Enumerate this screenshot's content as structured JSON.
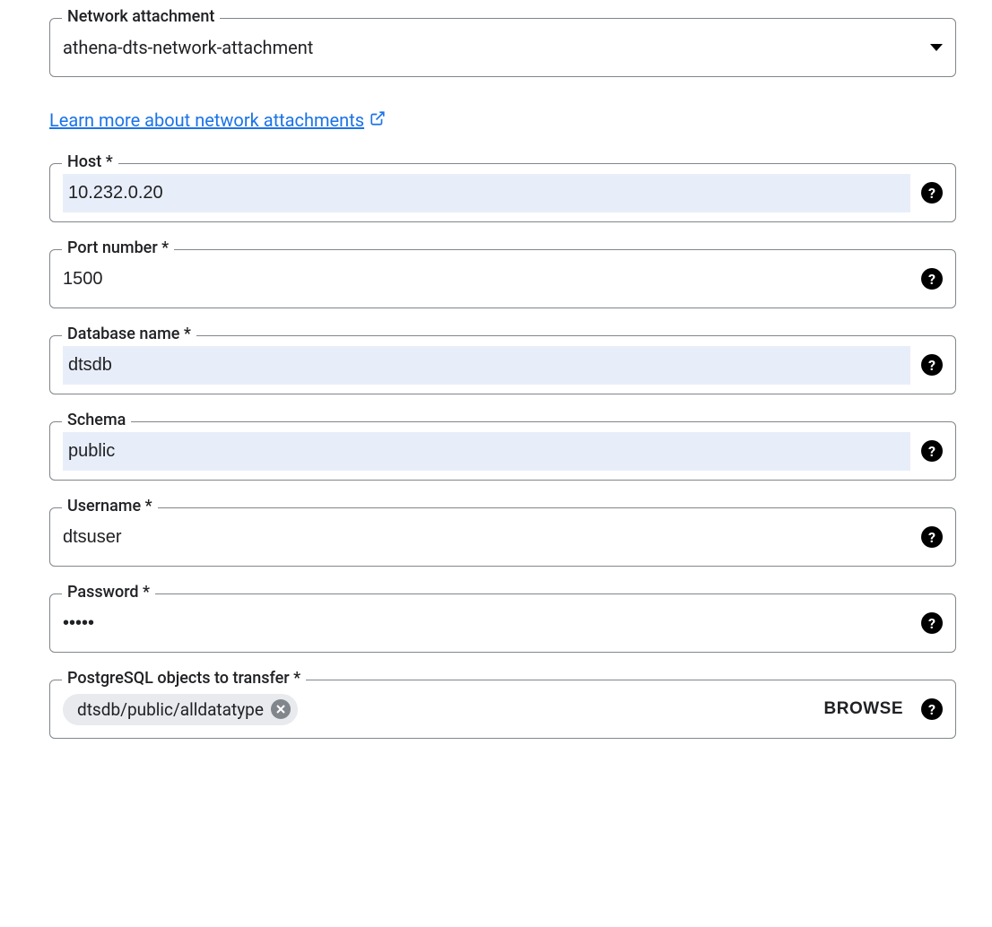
{
  "networkAttachment": {
    "label": "Network attachment",
    "value": "athena-dts-network-attachment"
  },
  "learnMoreLink": "Learn more about network attachments",
  "host": {
    "label": "Host *",
    "value": "10.232.0.20"
  },
  "portNumber": {
    "label": "Port number *",
    "value": "1500"
  },
  "databaseName": {
    "label": "Database name *",
    "value": "dtsdb"
  },
  "schema": {
    "label": "Schema",
    "value": "public"
  },
  "username": {
    "label": "Username *",
    "value": "dtsuser"
  },
  "password": {
    "label": "Password *",
    "value": "•••••"
  },
  "objectsToTransfer": {
    "label": "PostgreSQL objects to transfer *",
    "chip": "dtsdb/public/alldatatype",
    "browseLabel": "BROWSE"
  },
  "helpIcon": "?"
}
